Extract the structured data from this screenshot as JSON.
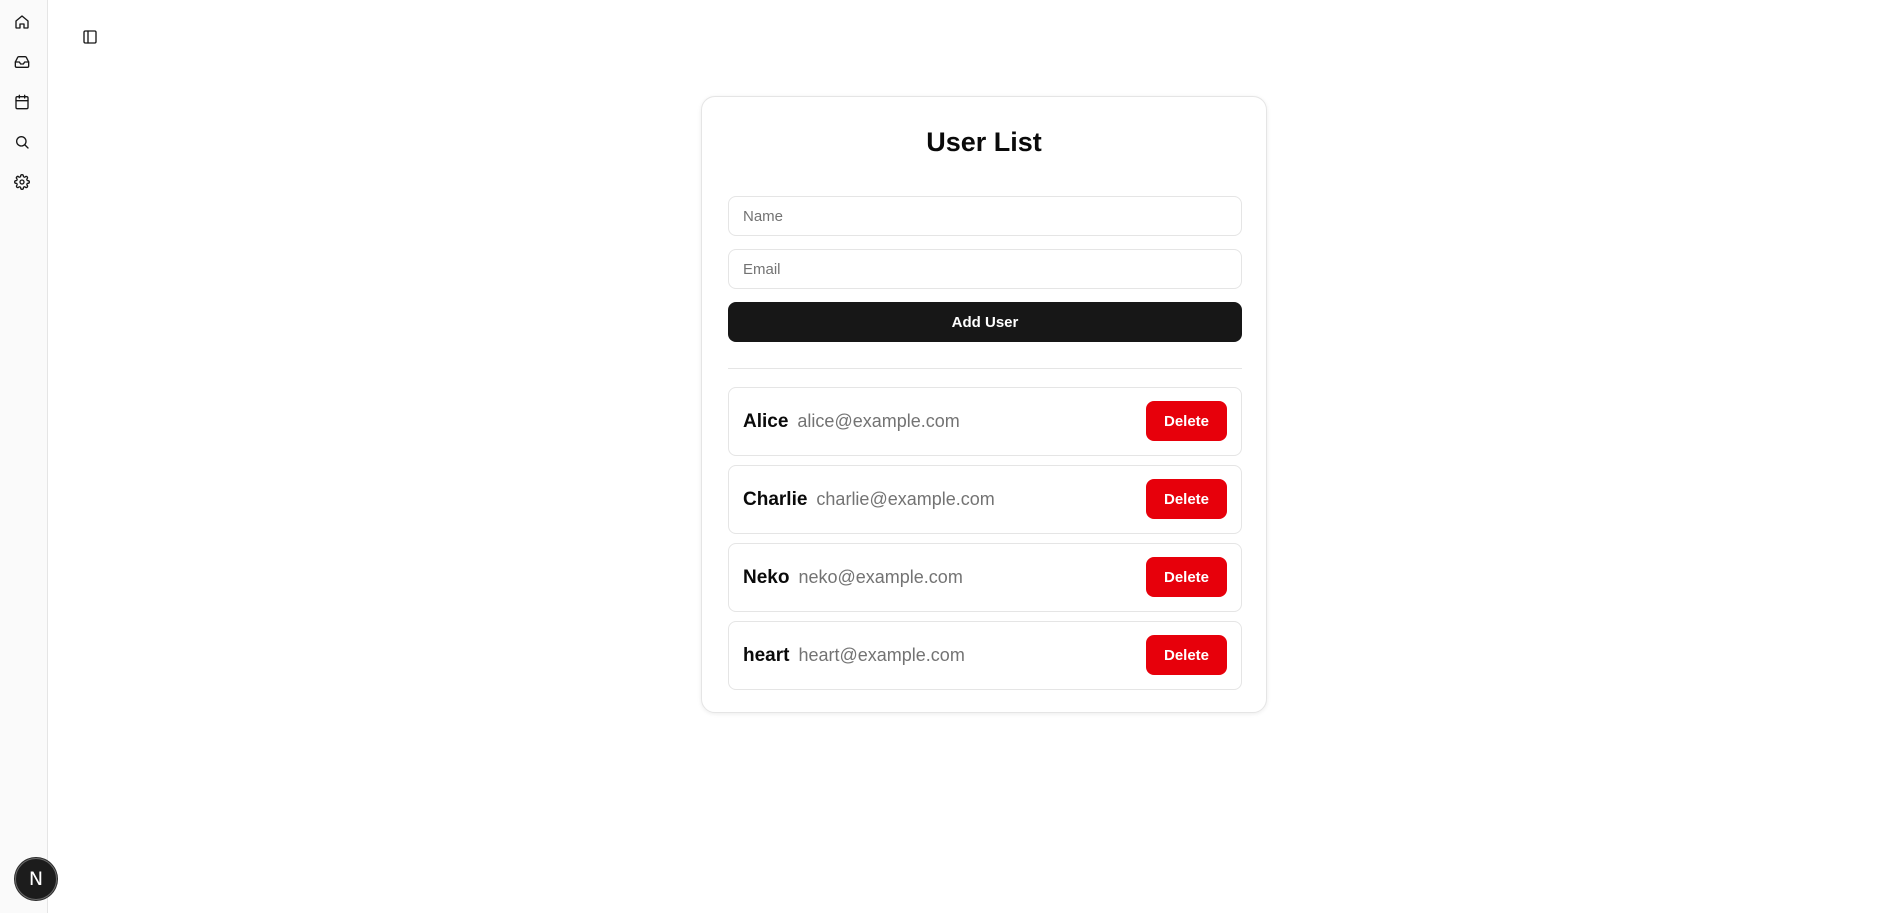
{
  "sidebar": {
    "items": [
      {
        "icon": "home-icon"
      },
      {
        "icon": "inbox-icon"
      },
      {
        "icon": "calendar-icon"
      },
      {
        "icon": "search-icon"
      },
      {
        "icon": "settings-icon"
      }
    ],
    "avatar_letter": "N"
  },
  "main": {
    "title": "User List",
    "name_placeholder": "Name",
    "email_placeholder": "Email",
    "add_button": "Add User",
    "users": [
      {
        "name": "Alice",
        "email": "alice@example.com",
        "delete_label": "Delete"
      },
      {
        "name": "Charlie",
        "email": "charlie@example.com",
        "delete_label": "Delete"
      },
      {
        "name": "Neko",
        "email": "neko@example.com",
        "delete_label": "Delete"
      },
      {
        "name": "heart",
        "email": "heart@example.com",
        "delete_label": "Delete"
      }
    ]
  },
  "colors": {
    "primary_button": "#171717",
    "delete_button": "#e7000b",
    "muted_text": "#737373",
    "border": "#e5e5e5"
  }
}
